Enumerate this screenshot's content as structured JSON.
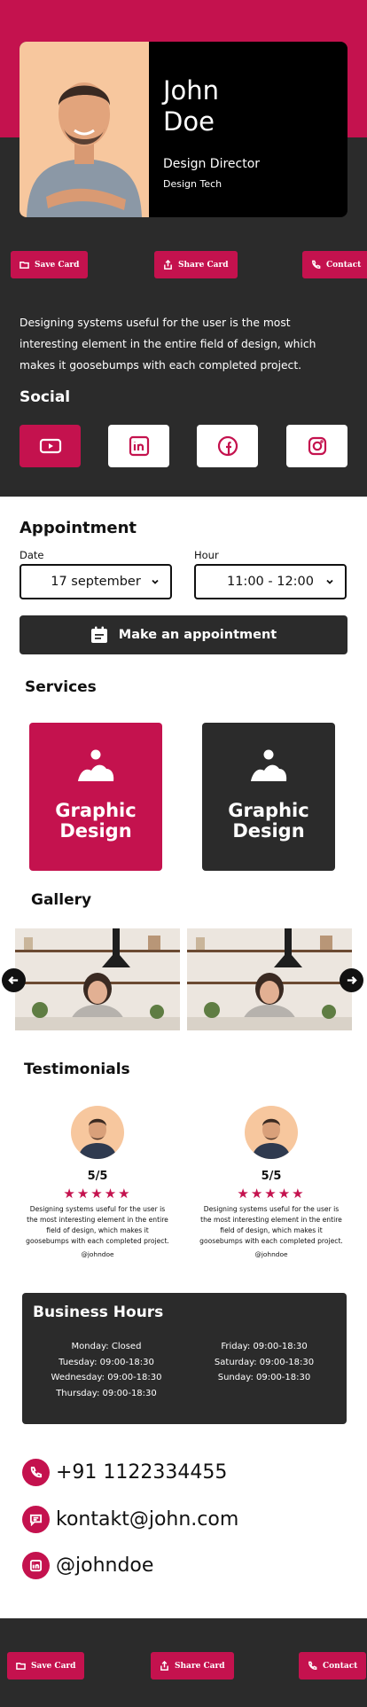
{
  "profile": {
    "first_name": "John",
    "last_name": "Doe",
    "role": "Design Director",
    "company": "Design Tech"
  },
  "actions": {
    "save_card": "Save Card",
    "share_card": "Share Card",
    "contact": "Contact"
  },
  "bio": "Designing systems useful for the user is the most interesting element in the entire field of design, which makes it goosebumps with each completed project.",
  "social": {
    "title": "Social",
    "items": [
      "youtube-icon",
      "linkedin-icon",
      "facebook-icon",
      "instagram-icon"
    ]
  },
  "appointment": {
    "title": "Appointment",
    "date_label": "Date",
    "date_value": "17 september",
    "hour_label": "Hour",
    "hour_value": "11:00 - 12:00",
    "button_label": "Make an appointment"
  },
  "services": {
    "title": "Services",
    "items": [
      {
        "label": "Graphic Design",
        "color": "#c4124e"
      },
      {
        "label": "Graphic Design",
        "color": "#2b2b2b"
      }
    ]
  },
  "gallery": {
    "title": "Gallery"
  },
  "testimonials": {
    "title": "Testimonials",
    "items": [
      {
        "score": "5/5",
        "stars": "★★★★★",
        "text": "Designing systems useful for the user is the most interesting element in the entire field of design, which makes it goosebumps with each completed project.",
        "handle": "@johndoe"
      },
      {
        "score": "5/5",
        "stars": "★★★★★",
        "text": "Designing systems useful for the user is the most interesting element in the entire field of design, which makes it goosebumps with each completed project.",
        "handle": "@johndoe"
      }
    ]
  },
  "business_hours": {
    "title": "Business Hours",
    "monday": "Monday: Closed",
    "tuesday": "Tuesday: 09:00-18:30",
    "wednesday": "Wednesday: 09:00-18:30",
    "thursday": "Thursday: 09:00-18:30",
    "friday": "Friday: 09:00-18:30",
    "saturday": "Saturday: 09:00-18:30",
    "sunday": "Sunday: 09:00-18:30"
  },
  "contact_info": {
    "phone": "+91 1122334455",
    "email": "kontakt@john.com",
    "linkedin": "@johndoe"
  },
  "colors": {
    "accent": "#c4124e",
    "dark": "#2b2b2b",
    "photo_bg": "#f7c79e"
  }
}
